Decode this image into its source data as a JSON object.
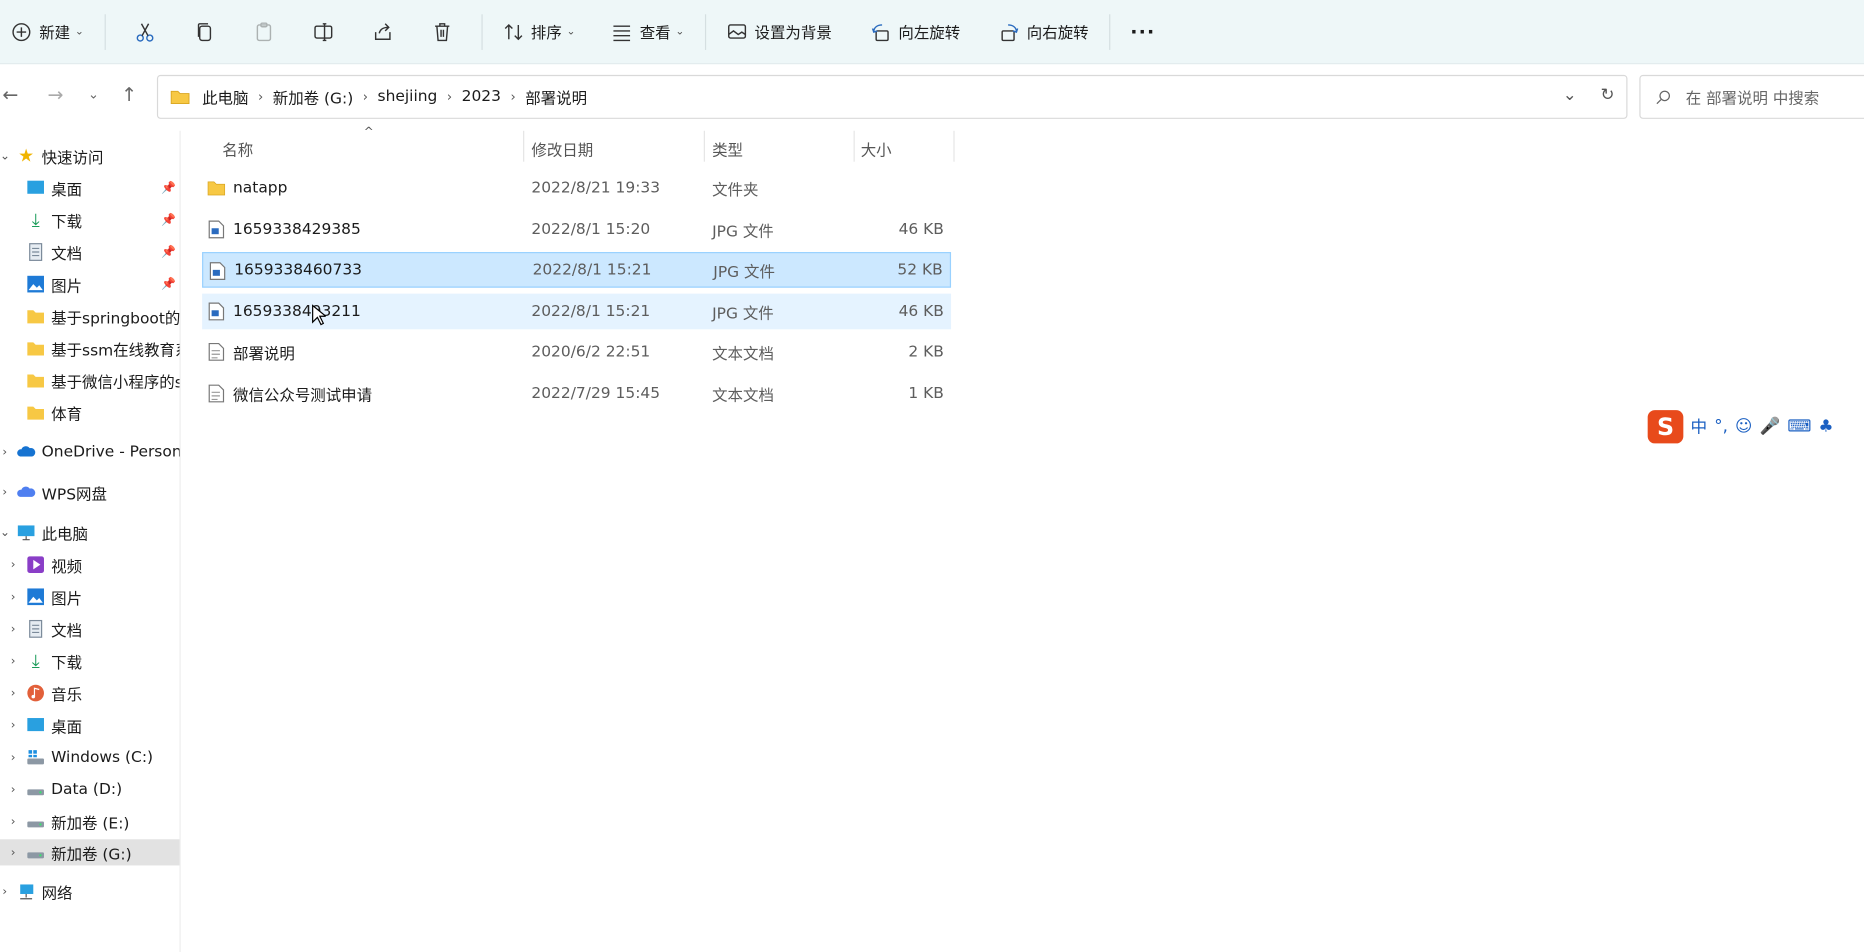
{
  "toolbar": {
    "new_label": "新建",
    "sort_label": "排序",
    "view_label": "查看",
    "set_background_label": "设置为背景",
    "rotate_left_label": "向左旋转",
    "rotate_right_label": "向右旋转",
    "more_label": "···"
  },
  "address": {
    "crumbs": [
      "此电脑",
      "新加卷 (G:)",
      "shejiing",
      "2023",
      "部署说明"
    ]
  },
  "search": {
    "placeholder": "在 部署说明 中搜索"
  },
  "sidebar": {
    "quick_access": "快速访问",
    "quick_items": [
      "桌面",
      "下载",
      "文档",
      "图片",
      "基于springboot的",
      "基于ssm在线教育系",
      "基于微信小程序的sp",
      "体育"
    ],
    "onedrive": "OneDrive - Persona",
    "wps": "WPS网盘",
    "this_pc": "此电脑",
    "pc_items": [
      "视频",
      "图片",
      "文档",
      "下载",
      "音乐",
      "桌面",
      "Windows (C:)",
      "Data (D:)",
      "新加卷 (E:)",
      "新加卷 (G:)"
    ],
    "network": "网络"
  },
  "columns": {
    "name": "名称",
    "date": "修改日期",
    "type": "类型",
    "size": "大小"
  },
  "files": [
    {
      "name": "natapp",
      "date": "2022/8/21 19:33",
      "type": "文件夹",
      "size": ""
    },
    {
      "name": "1659338429385",
      "date": "2022/8/1 15:20",
      "type": "JPG 文件",
      "size": "46 KB"
    },
    {
      "name": "1659338460733",
      "date": "2022/8/1 15:21",
      "type": "JPG 文件",
      "size": "52 KB"
    },
    {
      "name": "1659338493211",
      "date": "2022/8/1 15:21",
      "type": "JPG 文件",
      "size": "46 KB"
    },
    {
      "name": "部署说明",
      "date": "2020/6/2 22:51",
      "type": "文本文档",
      "size": "2 KB"
    },
    {
      "name": "微信公众号测试申请",
      "date": "2022/7/29 15:45",
      "type": "文本文档",
      "size": "1 KB"
    }
  ],
  "ime": {
    "mode_label": "中",
    "punct_label": "°,"
  }
}
